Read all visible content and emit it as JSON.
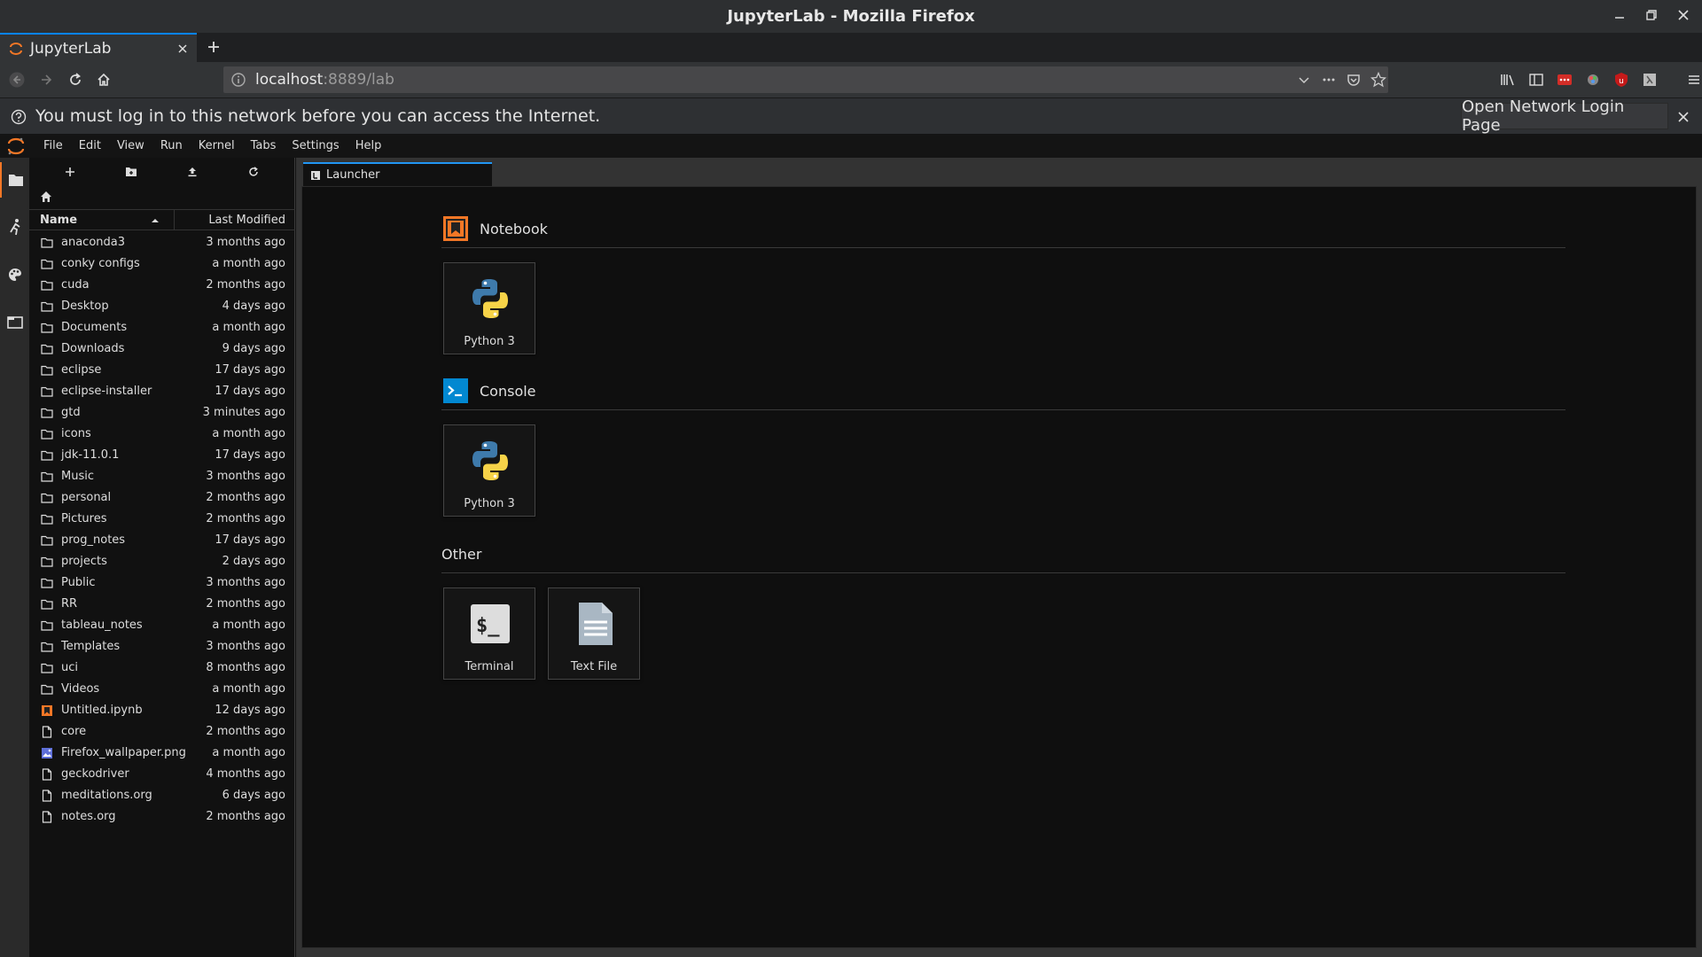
{
  "window": {
    "title": "JupyterLab - Mozilla Firefox"
  },
  "browser": {
    "tab_title": "JupyterLab",
    "url_host": "localhost",
    "url_rest": ":8889/lab"
  },
  "notification": {
    "message": "You must log in to this network before you can access the Internet.",
    "button_label": "Open Network Login Page"
  },
  "menubar": {
    "items": [
      "File",
      "Edit",
      "View",
      "Run",
      "Kernel",
      "Tabs",
      "Settings",
      "Help"
    ]
  },
  "filebrowser": {
    "columns": {
      "name": "Name",
      "modified": "Last Modified"
    },
    "files": [
      {
        "name": "anaconda3",
        "modified": "3 months ago",
        "kind": "folder"
      },
      {
        "name": "conky configs",
        "modified": "a month ago",
        "kind": "folder"
      },
      {
        "name": "cuda",
        "modified": "2 months ago",
        "kind": "folder"
      },
      {
        "name": "Desktop",
        "modified": "4 days ago",
        "kind": "folder"
      },
      {
        "name": "Documents",
        "modified": "a month ago",
        "kind": "folder"
      },
      {
        "name": "Downloads",
        "modified": "9 days ago",
        "kind": "folder"
      },
      {
        "name": "eclipse",
        "modified": "17 days ago",
        "kind": "folder"
      },
      {
        "name": "eclipse-installer",
        "modified": "17 days ago",
        "kind": "folder"
      },
      {
        "name": "gtd",
        "modified": "3 minutes ago",
        "kind": "folder"
      },
      {
        "name": "icons",
        "modified": "a month ago",
        "kind": "folder"
      },
      {
        "name": "jdk-11.0.1",
        "modified": "17 days ago",
        "kind": "folder"
      },
      {
        "name": "Music",
        "modified": "3 months ago",
        "kind": "folder"
      },
      {
        "name": "personal",
        "modified": "2 months ago",
        "kind": "folder"
      },
      {
        "name": "Pictures",
        "modified": "2 months ago",
        "kind": "folder"
      },
      {
        "name": "prog_notes",
        "modified": "17 days ago",
        "kind": "folder"
      },
      {
        "name": "projects",
        "modified": "2 days ago",
        "kind": "folder"
      },
      {
        "name": "Public",
        "modified": "3 months ago",
        "kind": "folder"
      },
      {
        "name": "RR",
        "modified": "2 months ago",
        "kind": "folder"
      },
      {
        "name": "tableau_notes",
        "modified": "a month ago",
        "kind": "folder"
      },
      {
        "name": "Templates",
        "modified": "3 months ago",
        "kind": "folder"
      },
      {
        "name": "uci",
        "modified": "8 months ago",
        "kind": "folder"
      },
      {
        "name": "Videos",
        "modified": "a month ago",
        "kind": "folder"
      },
      {
        "name": "Untitled.ipynb",
        "modified": "12 days ago",
        "kind": "notebook"
      },
      {
        "name": "core",
        "modified": "2 months ago",
        "kind": "file"
      },
      {
        "name": "Firefox_wallpaper.png",
        "modified": "a month ago",
        "kind": "image"
      },
      {
        "name": "geckodriver",
        "modified": "4 months ago",
        "kind": "file"
      },
      {
        "name": "meditations.org",
        "modified": "6 days ago",
        "kind": "file"
      },
      {
        "name": "notes.org",
        "modified": "2 months ago",
        "kind": "file"
      }
    ]
  },
  "launcher": {
    "tab_label": "Launcher",
    "sections": {
      "notebook": {
        "title": "Notebook",
        "cards": [
          "Python 3"
        ]
      },
      "console": {
        "title": "Console",
        "cards": [
          "Python 3"
        ]
      },
      "other": {
        "title": "Other",
        "cards": [
          "Terminal",
          "Text File"
        ]
      }
    }
  },
  "colors": {
    "jupyter_orange": "#f37726",
    "accent_blue": "#2196f3",
    "console_blue": "#0288d1",
    "python_blue": "#3e7aab",
    "python_yellow": "#f7d348"
  }
}
